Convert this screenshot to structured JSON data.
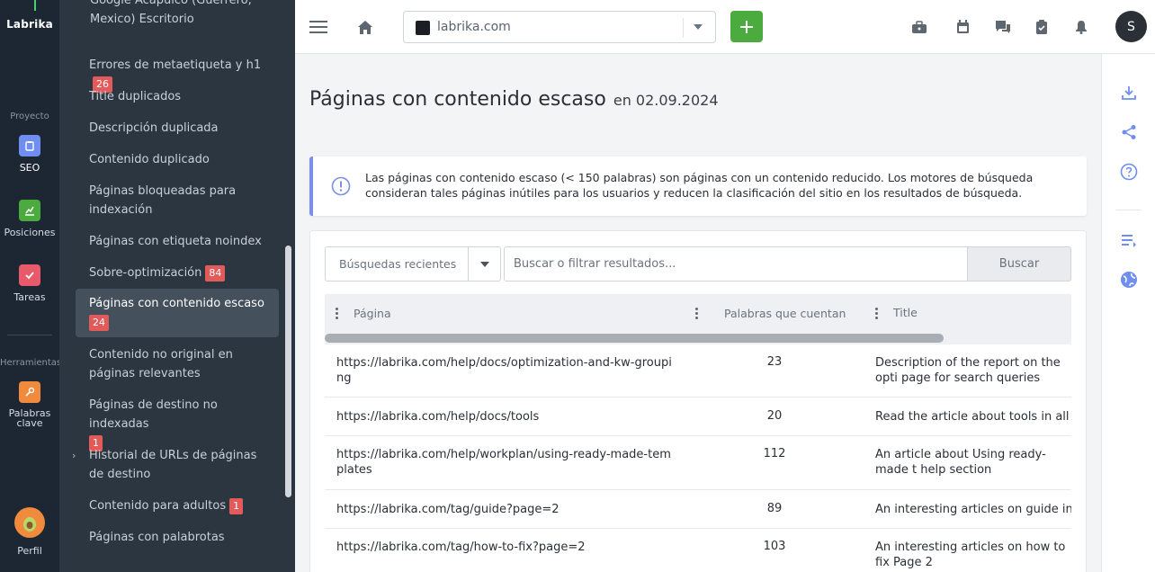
{
  "app": {
    "logo": "Labrika"
  },
  "rail": {
    "section_project": "Proyecto",
    "section_tools": "Herramientas",
    "items": [
      {
        "label": "SEO",
        "icon": "seo-icon",
        "color": "#6f8ef0",
        "active": true
      },
      {
        "label": "Posiciones",
        "icon": "chart-icon",
        "color": "#4cab3e"
      },
      {
        "label": "Tareas",
        "icon": "check-icon",
        "color": "#e85a6a"
      },
      {
        "label": "Palabras clave",
        "icon": "key-icon",
        "color": "#f08a3c"
      },
      {
        "label": "Perfil",
        "icon": "avatar-icon",
        "color": "#f08a3c"
      }
    ]
  },
  "sidebar": {
    "top_partial": "Google Acapulco (Guerrero, Mexico) Escritorio",
    "items": [
      {
        "label": "Errores de metaetiqueta y h1",
        "badge": "26"
      },
      {
        "label": "Title duplicados"
      },
      {
        "label": "Descripción duplicada"
      },
      {
        "label": "Contenido duplicado"
      },
      {
        "label": "Páginas bloqueadas para indexación"
      },
      {
        "label": "Páginas con etiqueta noindex"
      },
      {
        "label": "Sobre-optimización",
        "badge": "84"
      },
      {
        "label": "Páginas con contenido escaso",
        "badge": "24",
        "active": true
      },
      {
        "label": "Contenido no original en páginas relevantes"
      },
      {
        "label": "Páginas de destino no indexadas",
        "badge": "1"
      },
      {
        "label": "Historial de URLs de páginas de destino"
      },
      {
        "label": "Contenido para adultos",
        "badge": "1"
      },
      {
        "label": "Páginas con palabrotas"
      }
    ]
  },
  "topbar": {
    "project": "labrika.com",
    "user_initial": "S"
  },
  "page": {
    "title": "Páginas con contenido escaso",
    "date": "en 02.09.2024",
    "alert": "Las páginas con contenido escaso (< 150 palabras) son páginas con un contenido reducido. Los motores de búsqueda consideran tales páginas inútiles para los usuarios y reducen la clasificación del sitio en los resultados de búsqueda."
  },
  "filters": {
    "recent": "Búsquedas recientes",
    "search_placeholder": "Buscar o filtrar resultados...",
    "search_button": "Buscar"
  },
  "table": {
    "columns": [
      "Página",
      "Palabras que cuentan",
      "Title"
    ],
    "rows": [
      {
        "page": "https://labrika.com/help/docs/optimization-and-kw-grouping",
        "words": "23",
        "title": "Description of the report on the opti page for search queries"
      },
      {
        "page": "https://labrika.com/help/docs/tools",
        "words": "20",
        "title": "Read the article about tools in all in"
      },
      {
        "page": "https://labrika.com/help/workplan/using-ready-made-templates",
        "words": "112",
        "title": "An article about Using ready-made t help section"
      },
      {
        "page": "https://labrika.com/tag/guide?page=2",
        "words": "89",
        "title": "An interesting articles on guide in Sl"
      },
      {
        "page": "https://labrika.com/tag/how-to-fix?page=2",
        "words": "103",
        "title": "An interesting articles on how to fix Page 2"
      }
    ]
  }
}
